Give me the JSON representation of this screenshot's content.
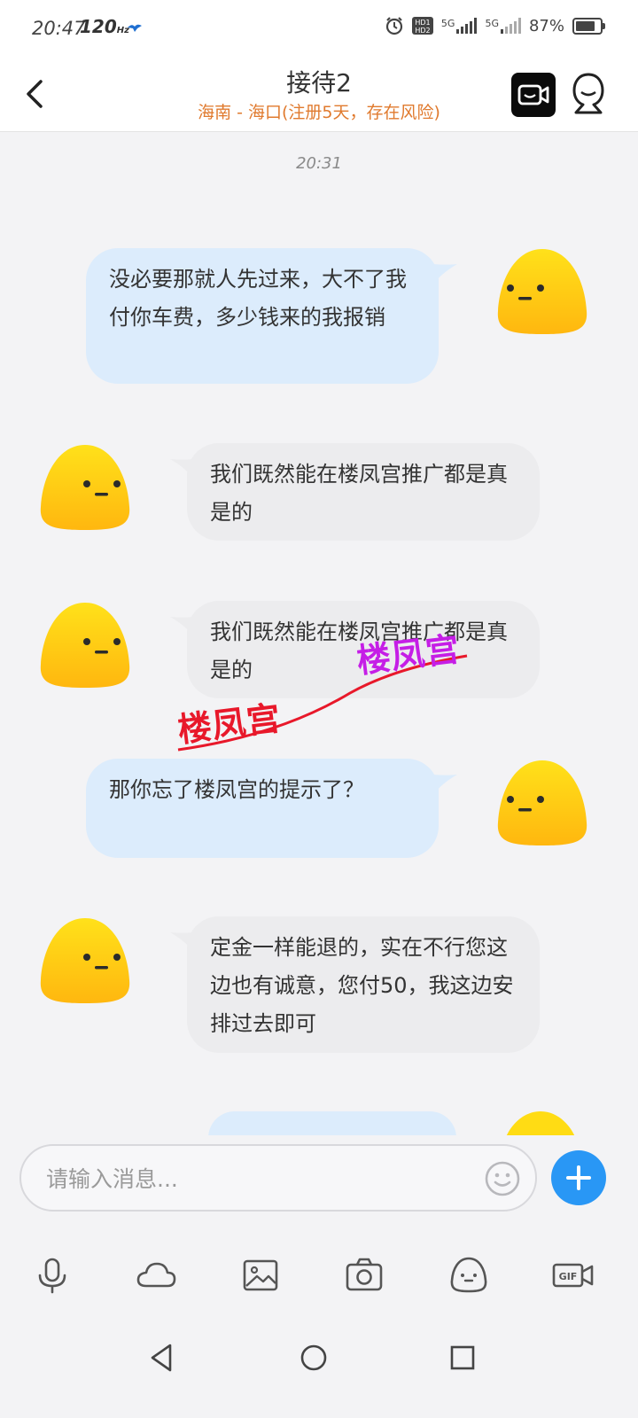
{
  "status_bar": {
    "time": "20:47",
    "refresh_rate": "120",
    "refresh_unit": "Hz",
    "network_1": "5G",
    "network_2": "5G",
    "battery": "87%",
    "battery_level": 0.87
  },
  "header": {
    "title": "接待2",
    "subtitle": "海南 - 海口(注册5天，存在风险)"
  },
  "chat": {
    "timestamp": "20:31",
    "messages": [
      {
        "side": "sent",
        "text": "没必要那就人先过来，大不了我付你车费，多少钱来的我报销"
      },
      {
        "side": "received",
        "text": "我们既然能在楼凤宫推广都是真是的"
      },
      {
        "side": "received",
        "text": "我们既然能在楼凤宫推广都是真是的"
      },
      {
        "side": "sent",
        "text": "那你忘了楼凤宫的提示了？"
      },
      {
        "side": "received",
        "text": "定金一样能退的，实在不行您这边也有诚意，您付50，我这边安排过去即可"
      }
    ]
  },
  "watermark": {
    "text_1": "楼凤宫",
    "text_2": "楼凤宫"
  },
  "input": {
    "placeholder": "请输入消息..."
  },
  "colors": {
    "sent_bubble": "#dcecfc",
    "received_bubble": "#ececee",
    "subtitle": "#e07a2e",
    "plus_button": "#2997f5",
    "watermark_red": "#e8182a",
    "watermark_purple": "#c51ee6"
  },
  "icons": {
    "toolbar": [
      "microphone-icon",
      "cloud-icon",
      "image-icon",
      "camera-icon",
      "sticker-icon",
      "gif-icon"
    ],
    "nav": [
      "back-triangle-icon",
      "home-circle-icon",
      "recents-square-icon"
    ]
  }
}
